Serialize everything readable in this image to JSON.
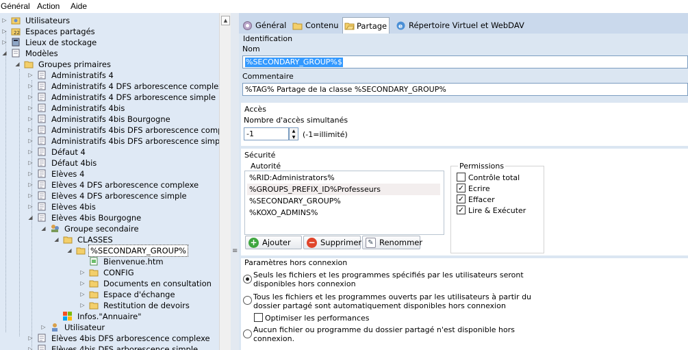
{
  "menu": {
    "general": "Général",
    "action": "Action",
    "aide": "Aide"
  },
  "tree": {
    "utilisateurs": "Utilisateurs",
    "espaces": "Espaces partagés",
    "lieux": "Lieux de stockage",
    "modeles": "Modèles",
    "groupes_primaires": "Groupes primaires",
    "items": [
      "Administratifs 4",
      "Administratifs 4 DFS arborescence complexe",
      "Administratifs 4 DFS arborescence simple",
      "Administratifs 4bis",
      "Administratifs 4bis Bourgogne",
      "Administratifs 4bis DFS arborescence complexe",
      "Administratifs 4bis DFS arborescence simple",
      "Défaut 4",
      "Défaut 4bis",
      "Elèves 4",
      "Elèves 4 DFS arborescence complexe",
      "Elèves 4 DFS arborescence simple",
      "Elèves 4bis",
      "Elèves 4bis Bourgogne"
    ],
    "groupe_secondaire": "Groupe secondaire",
    "classes": "CLASSES",
    "secondary_group": "%SECONDARY_GROUP%",
    "bienvenue": "Bienvenue.htm",
    "config": "CONFIG",
    "documents": "Documents en consultation",
    "espace_echange": "Espace d'échange",
    "restitution": "Restitution de devoirs",
    "infos": "Infos.\"Annuaire\"",
    "utilisateur": "Utilisateur",
    "after": [
      "Elèves 4bis DFS arborescence complexe",
      "Elèves 4bis DFS arborescence simple"
    ]
  },
  "tabs": {
    "general": "Général",
    "contenu": "Contenu",
    "partage": "Partage",
    "repertoire": "Répertoire Virtuel et WebDAV"
  },
  "identification": {
    "title": "Identification",
    "nom_label": "Nom",
    "nom_value": "%SECONDARY_GROUP%$",
    "commentaire_label": "Commentaire",
    "commentaire_value": "%TAG% Partage de la classe %SECONDARY_GROUP%"
  },
  "acces": {
    "title": "Accès",
    "label": "Nombre d'accès simultanés",
    "value": "-1",
    "hint": "(-1=illimité)"
  },
  "securite": {
    "title": "Sécurité",
    "autorite": "Autorité",
    "autorites": [
      "%RID:Administrators%",
      "%GROUPS_PREFIX_ID%Professeurs",
      "%SECONDARY_GROUP%",
      "%KOXO_ADMINS%"
    ],
    "ajouter": "Ajouter",
    "supprimer": "Supprimer",
    "renommer": "Renommer",
    "permissions_title": "Permissions",
    "permissions": [
      {
        "label": "Contrôle total",
        "checked": false
      },
      {
        "label": "Ecrire",
        "checked": true
      },
      {
        "label": "Effacer",
        "checked": true
      },
      {
        "label": "Lire & Exécuter",
        "checked": true
      }
    ]
  },
  "offline": {
    "title": "Paramètres hors connexion",
    "opt1": [
      "Seuls les fichiers et les programmes spécifiés par les utilisateurs seront",
      "disponibles hors connexion"
    ],
    "opt2": [
      "Tous les fichiers et les programmes ouverts par les utilisateurs à partir du",
      "dossier partagé sont automatiquement disponibles hors connexion"
    ],
    "optimize": "Optimiser les performances",
    "opt3": [
      "Aucun fichier ou programme du dossier partagé n'est disponible hors",
      "connexion."
    ]
  },
  "colors": {
    "tree_bg": "#dfe9f5",
    "panel_bg": "#dbe6f2",
    "selection": "#3399ff"
  }
}
